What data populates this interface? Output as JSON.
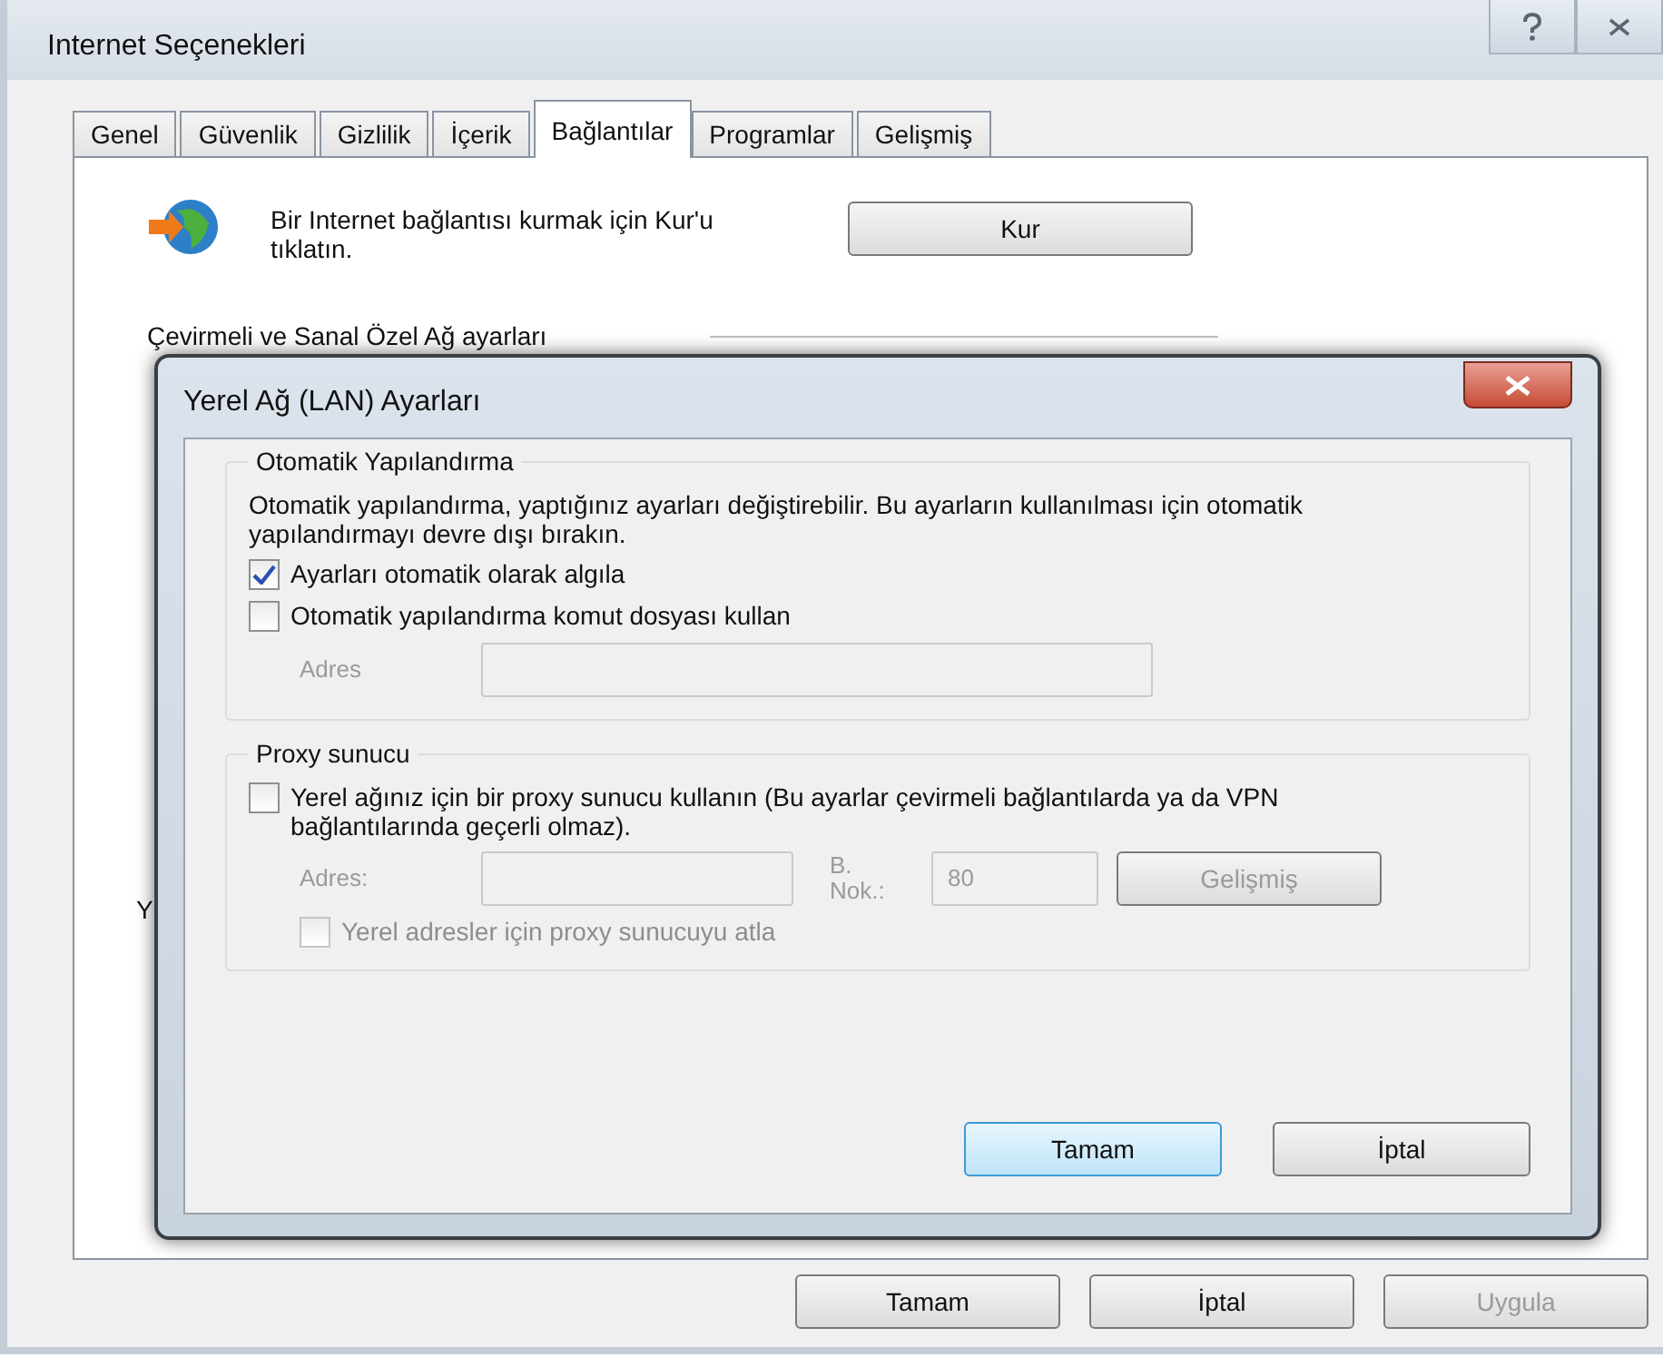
{
  "window": {
    "title": "Internet Seçenekleri"
  },
  "tabs": [
    {
      "label": "Genel",
      "selected": false
    },
    {
      "label": "Güvenlik",
      "selected": false
    },
    {
      "label": "Gizlilik",
      "selected": false
    },
    {
      "label": "İçerik",
      "selected": false
    },
    {
      "label": "Bağlantılar",
      "selected": true
    },
    {
      "label": "Programlar",
      "selected": false
    },
    {
      "label": "Gelişmiş",
      "selected": false
    }
  ],
  "setup": {
    "text": "Bir Internet bağlantısı kurmak için Kur'u tıklatın.",
    "button": "Kur"
  },
  "dialup_heading": "Çevirmeli ve Sanal Özel Ağ ayarları",
  "obscured_label": "Y",
  "buttons": [
    {
      "label": "Tamam",
      "disabled": false
    },
    {
      "label": "İptal",
      "disabled": false
    },
    {
      "label": "Uygula",
      "disabled": true
    }
  ],
  "lan_dialog": {
    "title": "Yerel Ağ (LAN) Ayarları",
    "auto_config": {
      "legend": "Otomatik Yapılandırma",
      "description": "Otomatik yapılandırma, yaptığınız ayarları değiştirebilir. Bu ayarların kullanılması için otomatik yapılandırmayı devre dışı bırakın.",
      "options": [
        {
          "label": "Ayarları otomatik olarak algıla",
          "checked": true
        },
        {
          "label": "Otomatik yapılandırma komut dosyası kullan",
          "checked": false
        }
      ],
      "address_label": "Adres",
      "address_disabled": true
    },
    "proxy": {
      "legend": "Proxy sunucu",
      "option": {
        "label": "Yerel ağınız için bir proxy sunucu kullanın (Bu ayarlar çevirmeli bağlantılarda ya da VPN bağlantılarında geçerli olmaz).",
        "checked": false
      },
      "disabled": true,
      "address_label": "Adres:",
      "port_label": "B. Nok.:",
      "port": "80",
      "advanced_button": "Gelişmiş",
      "bypass": {
        "label": "Yerel adresler için proxy sunucuyu atla",
        "checked": false
      }
    },
    "buttons": [
      {
        "label": "Tamam",
        "default": true
      },
      {
        "label": "İptal",
        "default": false
      }
    ]
  }
}
